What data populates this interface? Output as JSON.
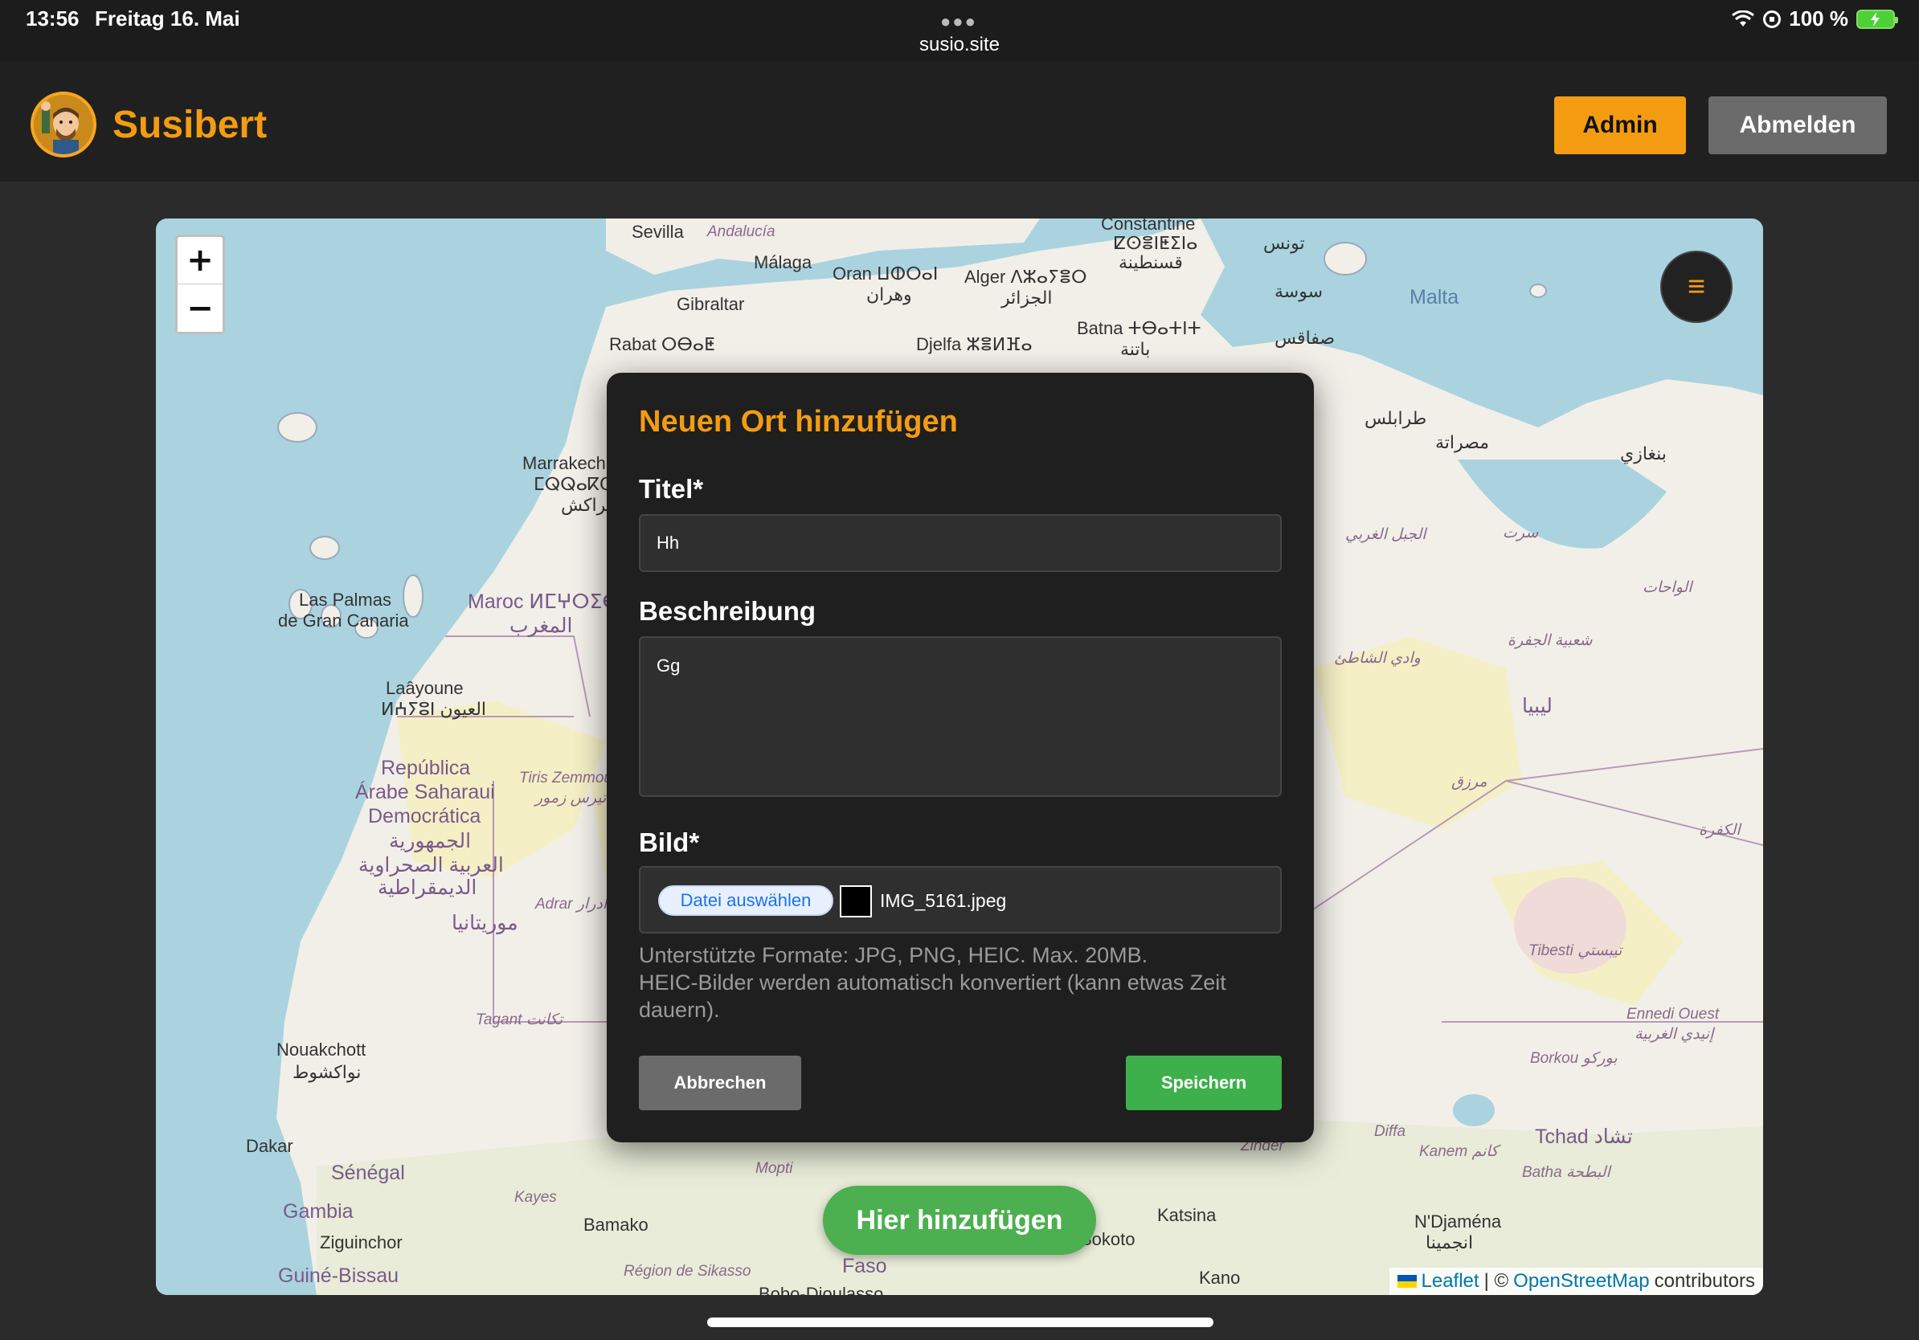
{
  "status_bar": {
    "time": "13:56",
    "date": "Freitag 16. Mai",
    "url": "susio.site",
    "battery": "100 %"
  },
  "header": {
    "brand": "Susibert",
    "admin_label": "Admin",
    "logout_label": "Abmelden"
  },
  "map": {
    "zoom_in": "+",
    "zoom_out": "−",
    "menu_icon": "≡",
    "attribution_leaflet": "Leaflet",
    "attribution_sep": "| ©",
    "attribution_osm": "OpenStreetMap",
    "attribution_tail": "contributors",
    "labels": [
      "Sevilla",
      "Andalucía",
      "Málaga",
      "Gibraltar",
      "Oran ⵡⵀⵔⴰⵏ",
      "وهران",
      "Alger ⴷⵣⴰⵢⴻⵔ",
      "الجزائر",
      "Constantine",
      "ⵇⵙⴻⵏⵟⵉⵏⴰ",
      "قسنطينة",
      "تونس",
      "سوسة",
      "صفاقس",
      "Malta",
      "Rabat ⵔⴱⴰⵟ",
      "Djelfa ⵣⴻⵍⴼⴰ",
      "Batna ⵜⴱⴰⵜⵏⵜ",
      "باتنة",
      "طرابلس",
      "مصراتة",
      "بنغازي",
      "Marrakech",
      "ⵎⵕⵕⴰⴽⵛ",
      "مراكش",
      "Las Palmas",
      "de Gran Canaria",
      "Maroc ⵍⵎⵖⵔⵉⴱ",
      "المغرب",
      "Laâyoune",
      "ⵍⵄⵢⵓⵏ العيون",
      "República",
      "Árabe Saharaui",
      "Democrática",
      "الجمهورية",
      "العربية الصحراوية",
      "الديمقراطية",
      "Tiris Zemmour",
      "تيرس زمور",
      "موريتانيا",
      "Adrar أدرار",
      "Tagant تكانت",
      "Nouakchott",
      "نواكشوط",
      "Dakar",
      "Sénégal",
      "Gambia",
      "Ziguinchor",
      "Guiné-Bissau",
      "Kayes",
      "Bamako",
      "Mopti",
      "Région de Sikasso",
      "Bobo-Dioulasso",
      "Zinder",
      "Katsina",
      "Sokoto",
      "Kano",
      "Diffa",
      "Kanem كانم",
      "Tchad تشاد",
      "Batha البطحة",
      "N'Djaména",
      "انجمينا",
      "Borkou بوركو",
      "Ennedi Ouest",
      "إنيدي الغربية",
      "Tibesti تيبستي",
      "الكفرة",
      "مرزق",
      "ليبيا",
      "شعبية الجفرة",
      "وادي الشاطئ",
      "الواحات",
      "سرت",
      "الجبل الغربي",
      "Faso"
    ]
  },
  "add_here_label": "Hier hinzufügen",
  "modal": {
    "title": "Neuen Ort hinzufügen",
    "title_label": "Titel*",
    "title_value": "Hh",
    "description_label": "Beschreibung",
    "description_value": "Gg",
    "image_label": "Bild*",
    "file_button": "Datei auswählen",
    "file_name": "IMG_5161.jpeg",
    "hint_line1": "Unterstützte Formate: JPG, PNG, HEIC. Max. 20MB.",
    "hint_line2": "HEIC-Bilder werden automatisch konvertiert (kann etwas Zeit dauern).",
    "cancel_label": "Abbrechen",
    "save_label": "Speichern"
  }
}
